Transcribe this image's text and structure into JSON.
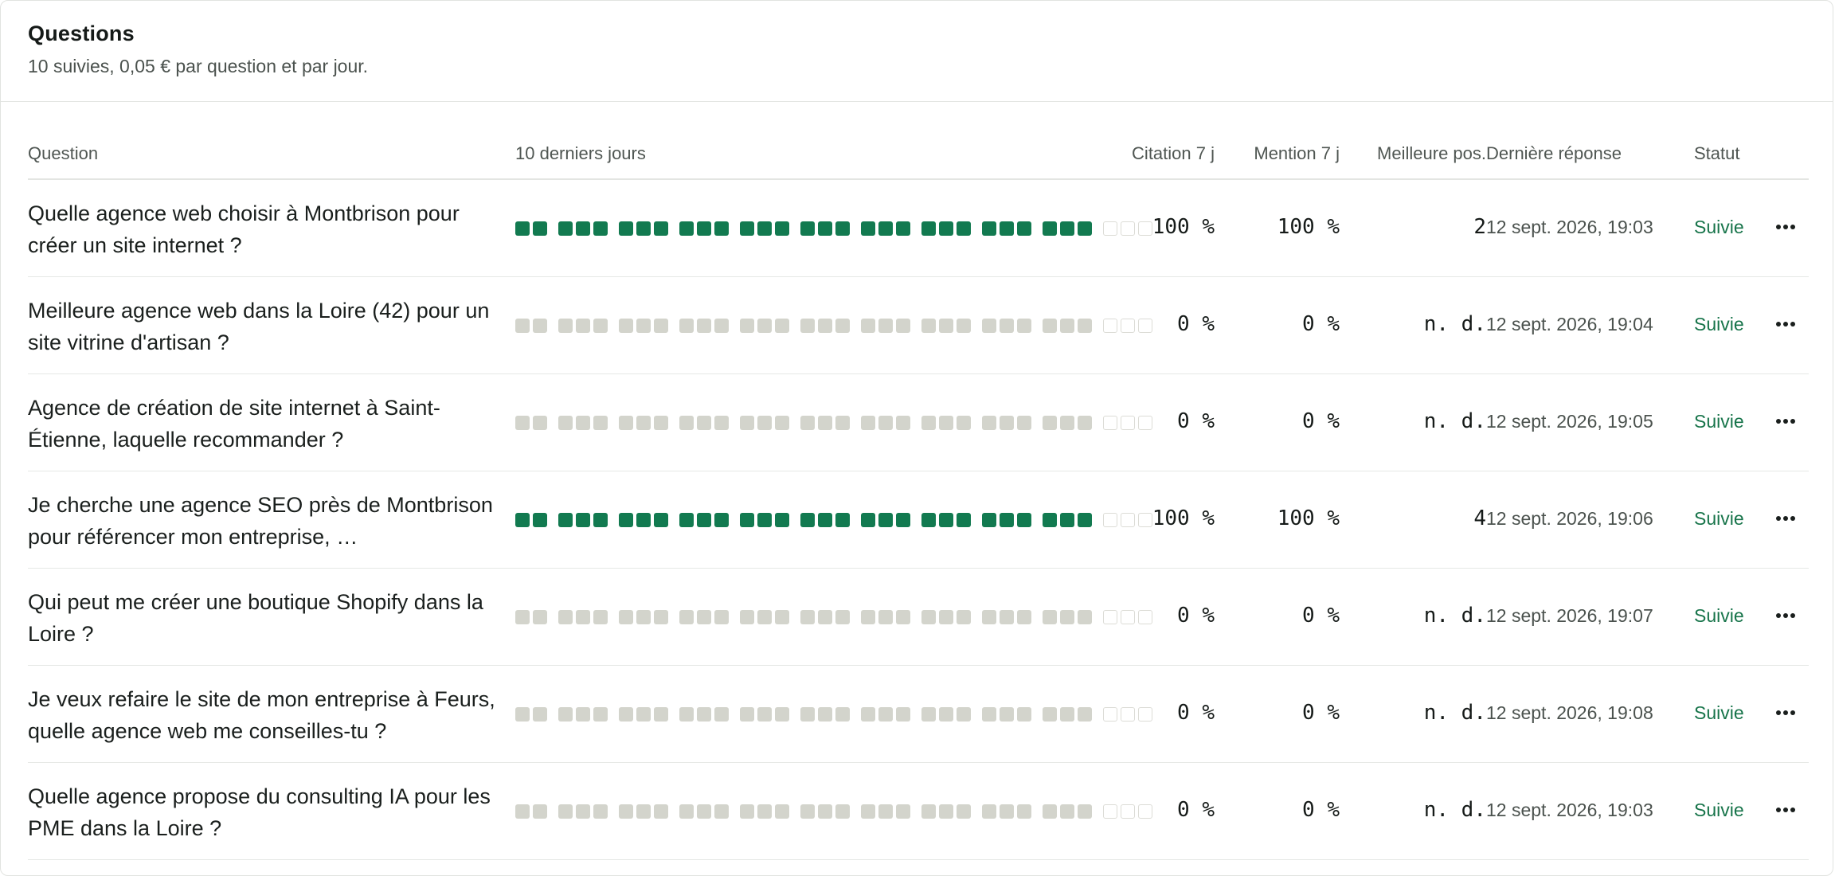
{
  "header": {
    "title": "Questions",
    "subtitle": "10 suivies, 0,05 € par question et par jour."
  },
  "columns": {
    "question": "Question",
    "days": "10 derniers jours",
    "citation": "Citation 7 j",
    "mention": "Mention 7 j",
    "best": "Meilleure pos.",
    "last": "Dernière réponse",
    "status": "Statut"
  },
  "colors": {
    "active_day": "#127a50",
    "inactive_day": "#d3d4cc",
    "status_text": "#17744a"
  },
  "rows": [
    {
      "question": "Quelle agence web choisir à Montbrison pour créer un site internet ?",
      "history": "active",
      "citation": "100 %",
      "mention": "100 %",
      "best": "2",
      "last": "12 sept. 2026, 19:03",
      "status": "Suivie",
      "menu_icon": "more-horizontal-icon"
    },
    {
      "question": "Meilleure agence web dans la Loire (42) pour un site vitrine d'artisan ?",
      "history": "inactive",
      "citation": "0 %",
      "mention": "0 %",
      "best": "n. d.",
      "last": "12 sept. 2026, 19:04",
      "status": "Suivie",
      "menu_icon": "more-horizontal-icon"
    },
    {
      "question": "Agence de création de site internet à Saint-Étienne, laquelle recommander ?",
      "history": "inactive",
      "citation": "0 %",
      "mention": "0 %",
      "best": "n. d.",
      "last": "12 sept. 2026, 19:05",
      "status": "Suivie",
      "menu_icon": "more-horizontal-icon"
    },
    {
      "question": "Je cherche une agence SEO près de Montbrison pour référencer mon entreprise, …",
      "history": "active",
      "citation": "100 %",
      "mention": "100 %",
      "best": "4",
      "last": "12 sept. 2026, 19:06",
      "status": "Suivie",
      "menu_icon": "more-horizontal-icon"
    },
    {
      "question": "Qui peut me créer une boutique Shopify dans la Loire ?",
      "history": "inactive",
      "citation": "0 %",
      "mention": "0 %",
      "best": "n. d.",
      "last": "12 sept. 2026, 19:07",
      "status": "Suivie",
      "menu_icon": "more-horizontal-icon"
    },
    {
      "question": "Je veux refaire le site de mon entreprise à Feurs, quelle agence web me conseilles-tu ?",
      "history": "inactive",
      "citation": "0 %",
      "mention": "0 %",
      "best": "n. d.",
      "last": "12 sept. 2026, 19:08",
      "status": "Suivie",
      "menu_icon": "more-horizontal-icon"
    },
    {
      "question": "Quelle agence propose du consulting IA pour les PME dans la Loire ?",
      "history": "inactive",
      "citation": "0 %",
      "mention": "0 %",
      "best": "n. d.",
      "last": "12 sept. 2026, 19:03",
      "status": "Suivie",
      "menu_icon": "more-horizontal-icon"
    }
  ]
}
